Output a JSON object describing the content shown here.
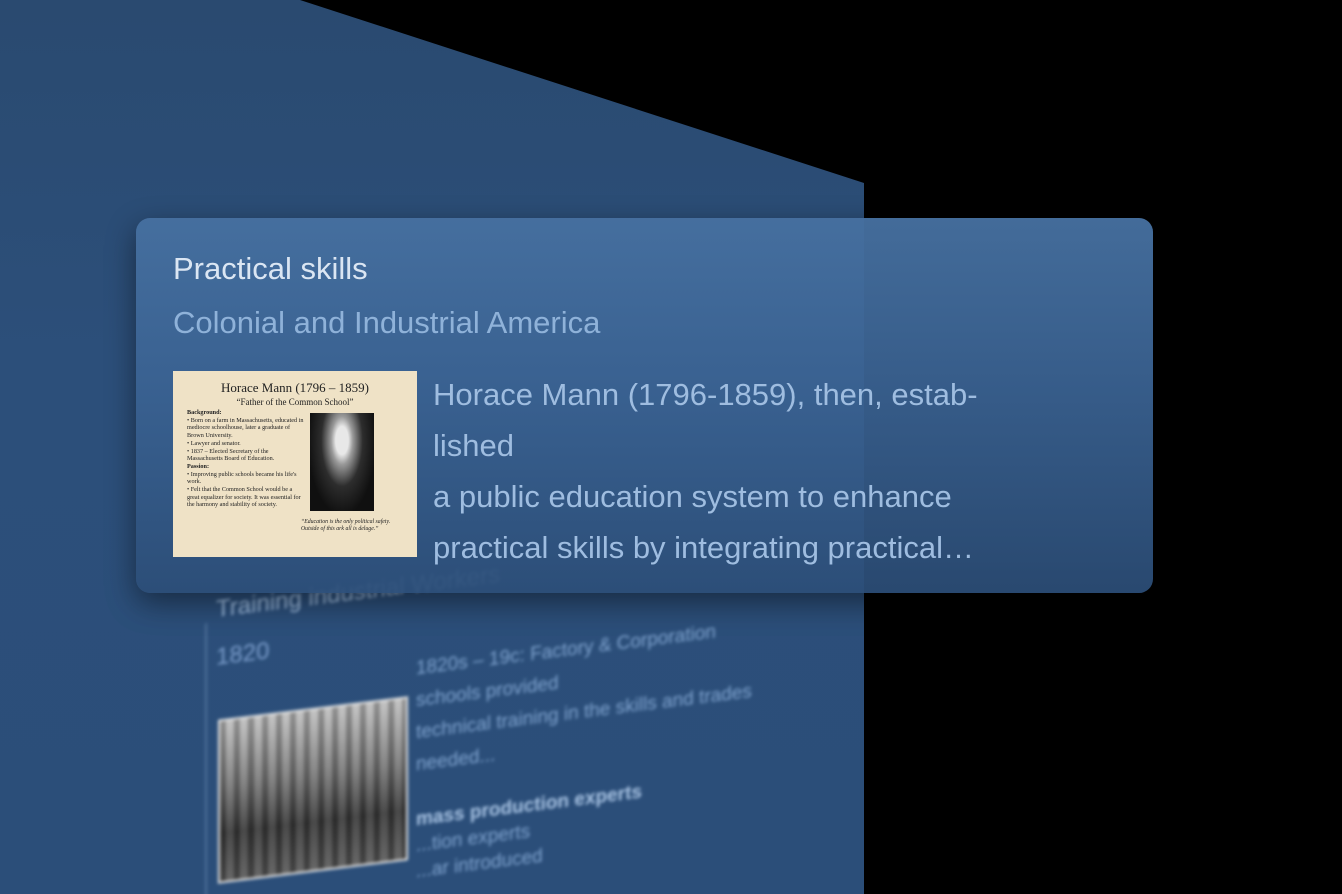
{
  "background_card": {
    "title": "Training industrial Workers",
    "year": "1820",
    "text_lines": [
      "1820s – 19c: Factory & Corporation",
      "schools provided",
      "technical training in the skills and trades",
      "needed..."
    ],
    "sub_heading": "mass production experts",
    "sub_lines": [
      "...tion experts",
      "...ar introduced"
    ]
  },
  "card": {
    "title": "Practical skills",
    "subtitle": "Colonial and Industrial America",
    "text_lines": [
      "Horace Mann (1796-1859), then, estab-",
      "lished",
      "a public education system to enhance",
      "practical skills by integrating practical…"
    ],
    "thumbnail": {
      "title": "Horace Mann (1796 – 1859)",
      "subtitle": "“Father of the Common School”",
      "background_heading": "Background:",
      "background_items": [
        "Born on a farm in Massachusetts, educated in mediocre schoolhouse, later a graduate of Brown University.",
        "Lawyer and senator.",
        "1837 – Elected Secretary of the Massachusetts Board of Education."
      ],
      "passion_heading": "Passion:",
      "passion_items": [
        "Improving public schools became his life's work.",
        "Felt that the Common School would be a great equalizer for society. It was essential for the harmony and stability of society."
      ],
      "quote": "“Education is the only political safety. Outside of this ark all is deluge.”"
    }
  },
  "colors": {
    "background": "#000000",
    "panel": "#2b4e79",
    "card_top": "#4670a0",
    "card_title": "#dbe6f3",
    "card_subtitle": "#8fb2d9",
    "card_text": "#9fbde0"
  }
}
